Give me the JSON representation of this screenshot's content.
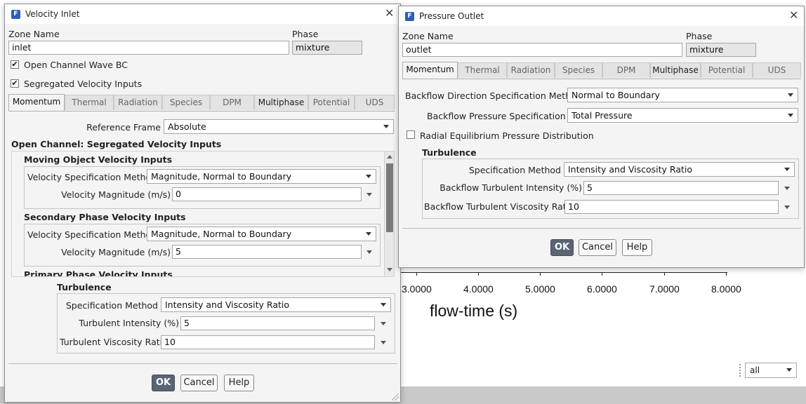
{
  "background": {
    "x_ticks": [
      "3.0000",
      "4.0000",
      "5.0000",
      "6.0000",
      "7.0000",
      "8.0000"
    ],
    "x_axis_title": "flow-time (s)",
    "selector_value": "all"
  },
  "velocity_inlet": {
    "title": "Velocity Inlet",
    "zone_name_label": "Zone Name",
    "zone_name_value": "inlet",
    "phase_label": "Phase",
    "phase_value": "mixture",
    "open_channel_wave_bc_label": "Open Channel Wave BC",
    "segregated_velocity_inputs_label": "Segregated Velocity Inputs",
    "tabs": [
      "Momentum",
      "Thermal",
      "Radiation",
      "Species",
      "DPM",
      "Multiphase",
      "Potential",
      "UDS"
    ],
    "reference_frame_label": "Reference Frame",
    "reference_frame_value": "Absolute",
    "open_channel_heading": "Open Channel: Segregated Velocity Inputs",
    "moving_object_heading": "Moving Object Velocity Inputs",
    "mo_spec_method_label": "Velocity Specification Method",
    "mo_spec_method_value": "Magnitude, Normal to Boundary",
    "mo_vel_mag_label": "Velocity Magnitude (m/s)",
    "mo_vel_mag_value": "0",
    "secondary_heading": "Secondary Phase Velocity Inputs",
    "sp_spec_method_label": "Velocity Specification Method",
    "sp_spec_method_value": "Magnitude, Normal to Boundary",
    "sp_vel_mag_label": "Velocity Magnitude (m/s)",
    "sp_vel_mag_value": "5",
    "primary_heading": "Primary Phase Velocity Inputs",
    "turbulence_heading": "Turbulence",
    "turb_spec_method_label": "Specification Method",
    "turb_spec_method_value": "Intensity and Viscosity Ratio",
    "turb_intensity_label": "Turbulent Intensity (%)",
    "turb_intensity_value": "5",
    "turb_visc_ratio_label": "Turbulent Viscosity Ratio",
    "turb_visc_ratio_value": "10",
    "ok_label": "OK",
    "cancel_label": "Cancel",
    "help_label": "Help"
  },
  "pressure_outlet": {
    "title": "Pressure Outlet",
    "zone_name_label": "Zone Name",
    "zone_name_value": "outlet",
    "phase_label": "Phase",
    "phase_value": "mixture",
    "tabs": [
      "Momentum",
      "Thermal",
      "Radiation",
      "Species",
      "DPM",
      "Multiphase",
      "Potential",
      "UDS"
    ],
    "backflow_dir_label": "Backflow Direction Specification Method",
    "backflow_dir_value": "Normal to Boundary",
    "backflow_pressure_label": "Backflow Pressure Specification",
    "backflow_pressure_value": "Total Pressure",
    "radial_eq_label": "Radial Equilibrium Pressure Distribution",
    "turbulence_heading": "Turbulence",
    "turb_spec_method_label": "Specification Method",
    "turb_spec_method_value": "Intensity and Viscosity Ratio",
    "bf_turb_intensity_label": "Backflow Turbulent Intensity (%)",
    "bf_turb_intensity_value": "5",
    "bf_turb_visc_label": "Backflow Turbulent Viscosity Ratio",
    "bf_turb_visc_value": "10",
    "ok_label": "OK",
    "cancel_label": "Cancel",
    "help_label": "Help"
  },
  "icons": {
    "app_icon_glyph": "F",
    "close_glyph": "✕",
    "check_glyph": "✔"
  },
  "colors": {
    "primary_button": "#5a6475",
    "app_icon": "#2b5fb3"
  }
}
